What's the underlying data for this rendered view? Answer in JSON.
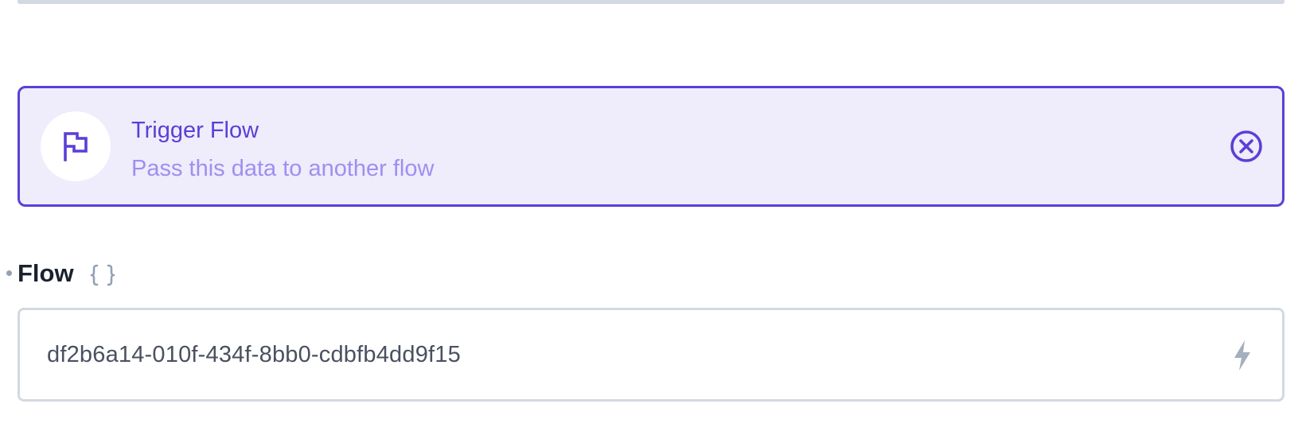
{
  "trigger": {
    "title": "Trigger Flow",
    "subtitle": "Pass this data to another flow",
    "icon": "flag-icon",
    "remove_icon": "close-circle-icon"
  },
  "flow_field": {
    "label": "Flow",
    "code_icon": "code-braces-icon",
    "value": "df2b6a14-010f-434f-8bb0-cdbfb4dd9f15",
    "action_icon": "bolt-icon"
  },
  "colors": {
    "accent": "#5b3fd6",
    "card_background": "#efecfc",
    "subtitle": "#9f8fef",
    "border": "#d3d9e2",
    "label": "#1a2230",
    "muted_icon": "#94a0b3"
  }
}
